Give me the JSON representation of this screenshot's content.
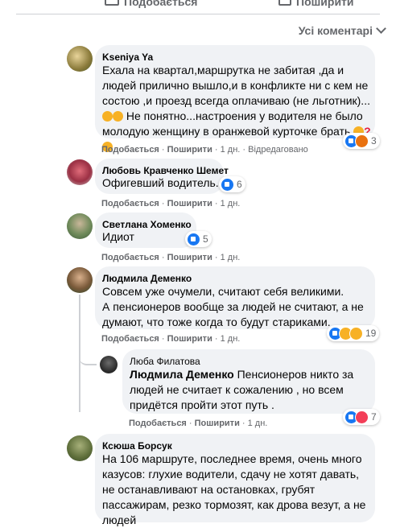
{
  "top": {
    "like_label": "Подобається",
    "share_label": "Поширити"
  },
  "filter": {
    "label": "Усі коментарі"
  },
  "comments": [
    {
      "author": "Kseniya Ya",
      "text": "Ехала на квартал,маршрутка не забитая ,да и людей прилично вышло,и в конфликте ни с кем не состою ,и проезд всегда оплачиваю (не льготник)...",
      "text2": " Не понятно...настроения у водителя не было молодую женщину в оранжевой курточке брать",
      "like": "Подобається",
      "share": "Поширити",
      "time": "1 дн.",
      "edited": "Відредаговано",
      "reaction_count": "3"
    },
    {
      "author": "Любовь Кравченко Шемет",
      "text": "Офигевший водитель...",
      "like": "Подобається",
      "share": "Поширити",
      "time": "1 дн.",
      "reaction_count": "6"
    },
    {
      "author": "Светлана Хоменко",
      "text": "Идиот",
      "like": "Подобається",
      "share": "Поширити",
      "time": "1 дн.",
      "reaction_count": "5"
    },
    {
      "author": "Людмила Деменко",
      "text": "Совсем уже очумели, считают себя великими.",
      "text2": "А пенсионеров вообще за людей не считают, а не думают, что тоже когда то будут стариками.",
      "like": "Подобається",
      "share": "Поширити",
      "time": "1 дн.",
      "reaction_count": "19"
    },
    {
      "author": "Люба Филатова",
      "mention": "Людмила Деменко",
      "text": " Пенсионеров никто за людей не считает к сожалению , но всем придётся пройти этот путь .",
      "like": "Подобається",
      "share": "Поширити",
      "time": "1 дн.",
      "reaction_count": "7"
    },
    {
      "author": "Ксюша Борсук",
      "text": "На 106 маршруте, последнее время, очень много казусов: глухие водители, сдачу не хотят давать, не останавливают на остановках, грубят пассажирам, резко тормозят, как дрова везут, а не людей"
    }
  ],
  "colors": {
    "bubble": "#f0f2f5",
    "meta": "#65676b",
    "like": "#1877f2"
  }
}
